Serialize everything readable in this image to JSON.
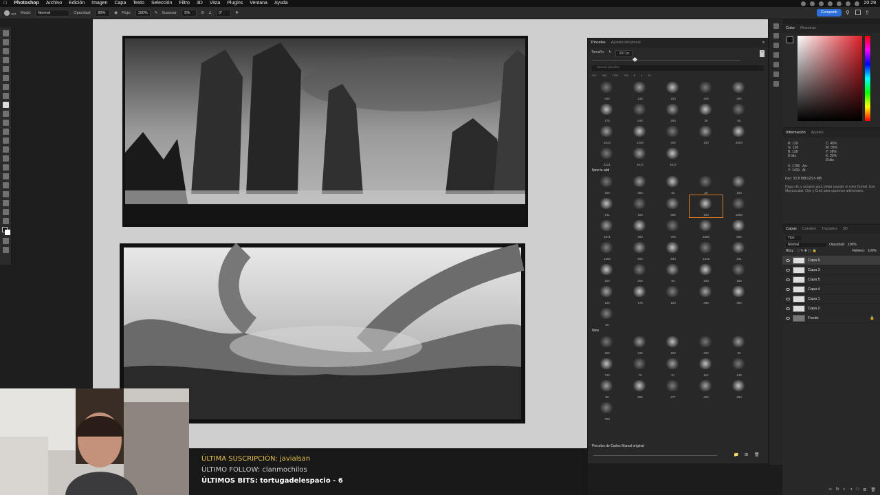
{
  "menubar": {
    "app": "Photoshop",
    "items": [
      "Archivo",
      "Edición",
      "Imagen",
      "Capa",
      "Texto",
      "Selección",
      "Filtro",
      "3D",
      "Vista",
      "Plugins",
      "Ventana",
      "Ayuda"
    ],
    "clock": "20:29"
  },
  "options": {
    "size": "207",
    "mode_label": "Modo:",
    "mode_value": "Normal",
    "opacity_label": "Opacidad:",
    "opacity_value": "90%",
    "flow_label": "Flujo:",
    "flow_value": "100%",
    "smoothing_label": "Suavizar:",
    "smoothing_value": "5%",
    "angle_value": "0°",
    "share": "Compartir"
  },
  "brushes_panel": {
    "tab_active": "Pinceles",
    "tab_inactive": "Ajustes del pincel",
    "size_label": "Tamaño:",
    "size_value": "207 px",
    "search_placeholder": "Buscar pinceles",
    "recent_sizes": [
      "207",
      "300",
      "1320",
      "706",
      "8",
      "1",
      "10"
    ],
    "group1_sizes": [
      "400",
      "125",
      "100",
      "400",
      "300",
      "175",
      "640",
      "200",
      "35",
      "50",
      "1043",
      "1400",
      "400",
      "100",
      "2500",
      "2231",
      "1617",
      "1617"
    ],
    "group2_title": "New to add",
    "group2_sizes": [
      "100",
      "300",
      "82",
      "30",
      "100",
      "141",
      "100",
      "896",
      "100",
      "1000",
      "1871",
      "400",
      "700",
      "2500",
      "800",
      "1400",
      "900",
      "600",
      "1448",
      "201",
      "100",
      "200",
      "50",
      "403",
      "150",
      "120",
      "175",
      "120",
      "296",
      "300",
      "50"
    ],
    "group3_title": "New",
    "group3_sizes": [
      "160",
      "236",
      "150",
      "200",
      "50",
      "743",
      "70",
      "67",
      "112",
      "145",
      "90",
      "965",
      "277",
      "200",
      "250",
      "700"
    ],
    "footer_group": "Pinceles de Carles Marsal original"
  },
  "color_panel": {
    "tab_active": "Color",
    "tab_inactive": "Muestras",
    "fg_color": "#111111",
    "bg_color": "#ffffff",
    "hue_color": "#e0202a"
  },
  "info_panel": {
    "tab_active": "Información",
    "tab_inactive": "Ajustes",
    "rgb_values": [
      "128",
      "128",
      "128"
    ],
    "cmyk": [
      "49%",
      "39%",
      "38%",
      "20%"
    ],
    "bits1": "8 bits",
    "bits2": "8 bits",
    "x": "1795",
    "y": "1439",
    "doc": "Doc: 32,8 MB/123,4 MB",
    "hint": "Haga clic y arrastre para pintar usando el color frontal. Use Mayúsculas, Opc y Cmd para opciones adicionales."
  },
  "layers_panel": {
    "tabs": [
      "Capas",
      "Canales",
      "Trazados",
      "3D"
    ],
    "filter": "Tipo",
    "blend": "Normal",
    "opacity_label": "Opacidad:",
    "opacity": "100%",
    "fill_label": "Relleno:",
    "fill": "100%",
    "lock_label": "Bloq.:",
    "layers": [
      "Capa 6",
      "Capa 3",
      "Capa 5",
      "Capa 4",
      "Capa 1",
      "Capa 2",
      "Fondo"
    ]
  },
  "stream_overlay": {
    "sub_label": "ÚLTIMA SUSCRIPCIÓN:",
    "sub_name": "javialsan",
    "follow_label": "ÚLTIMO FOLLOW:",
    "follow_name": "clanmochilos",
    "bits_label": "ÚLTIMOS BITS:",
    "bits_name": "tortugadelespacio - 6"
  }
}
